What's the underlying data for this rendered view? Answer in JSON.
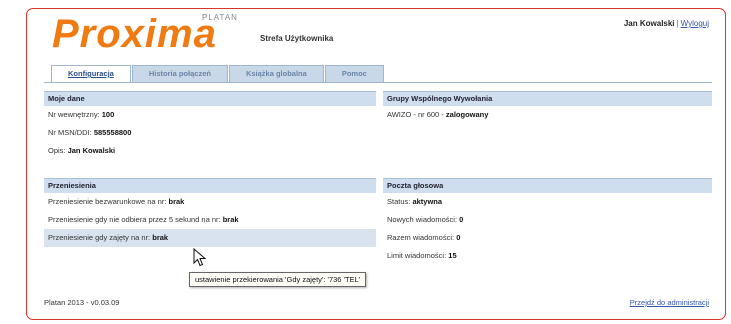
{
  "brand": {
    "logo_text": "Proxima",
    "logo_sub": "PLATAN",
    "subtitle": "Strefa Użytkownika"
  },
  "user": {
    "name": "Jan Kowalski",
    "separator": "|",
    "logout": "Wyloguj"
  },
  "tabs": [
    {
      "label": "Konfiguracja",
      "active": true
    },
    {
      "label": "Historia połączeń",
      "active": false
    },
    {
      "label": "Książka globalna",
      "active": false
    },
    {
      "label": "Pomoc",
      "active": false
    }
  ],
  "moje_dane": {
    "title": "Moje dane",
    "rows": [
      {
        "label": "Nr wewnętrzny: ",
        "value": "100"
      },
      {
        "label": "Nr MSN/DDI: ",
        "value": "585558800"
      },
      {
        "label": "Opis: ",
        "value": "Jan Kowalski"
      }
    ]
  },
  "grupy": {
    "title": "Grupy Wspólnego Wywołania",
    "rows": [
      {
        "label": "AWIZO - nr 600 - ",
        "value": "zalogowany"
      }
    ]
  },
  "przeniesienia": {
    "title": "Przeniesienia",
    "rows": [
      {
        "label": "Przeniesienie bezwarunkowe na nr: ",
        "value": "brak"
      },
      {
        "label": "Przeniesienie gdy nie odbiera przez 5 sekund na nr: ",
        "value": "brak"
      },
      {
        "label": "Przeniesienie gdy zajęty na nr: ",
        "value": "brak"
      }
    ]
  },
  "poczta": {
    "title": "Poczta głosowa",
    "rows": [
      {
        "label": "Status: ",
        "value": "aktywna"
      },
      {
        "label": "Nowych wiadomości: ",
        "value": "0"
      },
      {
        "label": "Razem wiadomości: ",
        "value": "0"
      },
      {
        "label": "Limit wiadomości: ",
        "value": "15"
      }
    ]
  },
  "tooltip": {
    "text": "ustawienie przekierowania 'Gdy zajęty': '736 'TEL'"
  },
  "footer": {
    "version": "Platan 2013 - v0.03.09",
    "admin_link": "Przejdź do administracji"
  },
  "colors": {
    "accent": "#f07b12",
    "frame_border": "#d8332f",
    "section_header": "#cfdeee",
    "tab_bg": "#c9d8e8",
    "link": "#3355aa"
  },
  "icons": {
    "cursor": "mouse-pointer-icon"
  }
}
